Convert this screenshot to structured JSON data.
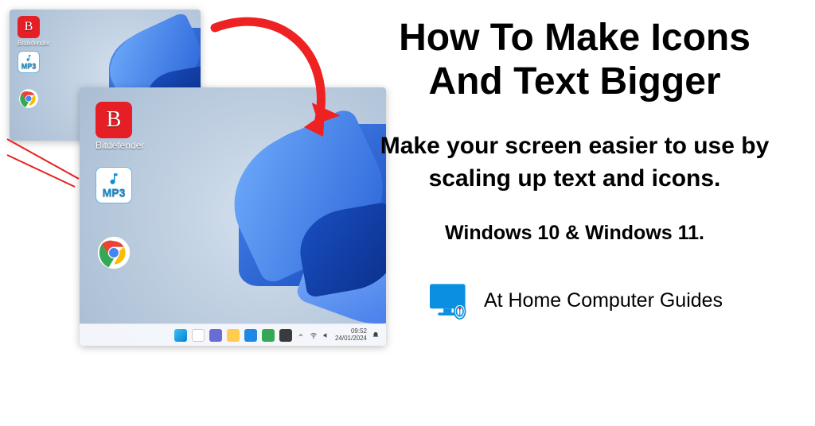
{
  "title": "How To Make Icons And Text Bigger",
  "subtitle": "Make your screen easier to use by scaling up text and icons.",
  "os_line": "Windows 10 & Windows 11.",
  "brand": "At Home Computer Guides",
  "desktop": {
    "icons": {
      "bitdefender_letter": "B",
      "bitdefender_label": "Bitdefender",
      "mp3_label": "MP3"
    },
    "tray": {
      "time": "09:52",
      "date": "24/01/2024"
    }
  }
}
